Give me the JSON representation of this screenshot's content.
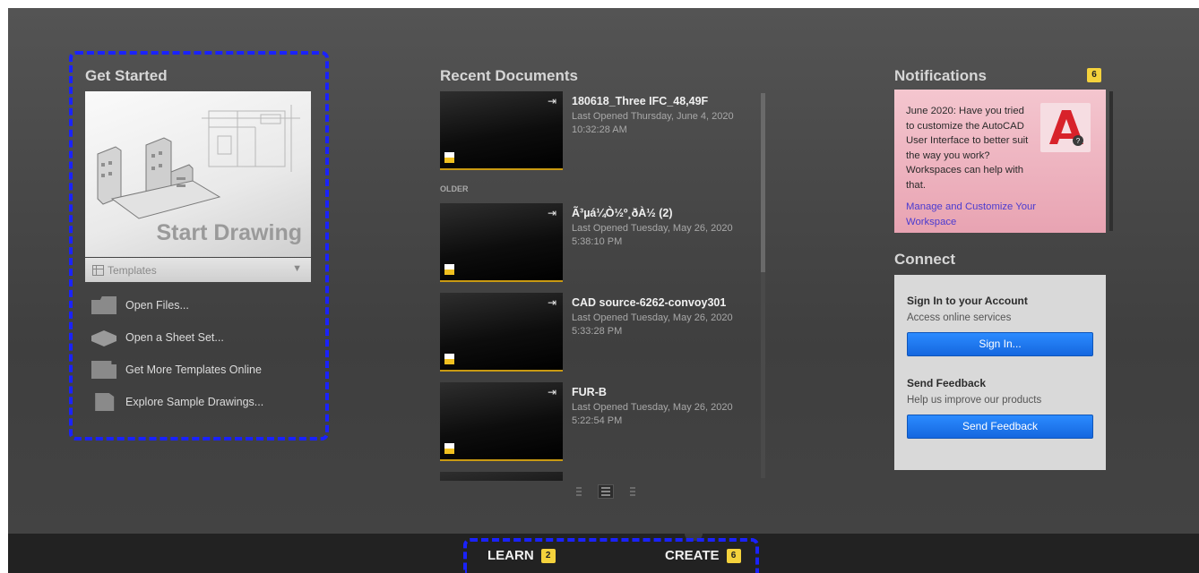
{
  "get_started": {
    "title": "Get Started",
    "start_drawing": "Start Drawing",
    "templates_label": "Templates",
    "links": [
      {
        "label": "Open Files...",
        "icon": "folder-icon"
      },
      {
        "label": "Open a Sheet Set...",
        "icon": "sheet-set-icon"
      },
      {
        "label": "Get More Templates Online",
        "icon": "templates-online-icon"
      },
      {
        "label": "Explore Sample Drawings...",
        "icon": "sample-drawings-icon"
      }
    ]
  },
  "recent": {
    "title": "Recent Documents",
    "older_label": "OLDER",
    "docs": [
      {
        "name": "180618_Three IFC_48,49F",
        "opened": "Last Opened Thursday, June 4, 2020",
        "time": "10:32:28 AM"
      },
      {
        "name": "Ã³µá¼Ò½º¸ðÀ½ (2)",
        "opened": "Last Opened Tuesday, May 26, 2020",
        "time": "5:38:10 PM"
      },
      {
        "name": "CAD source-6262-convoy301",
        "opened": "Last Opened Tuesday, May 26, 2020",
        "time": "5:33:28 PM"
      },
      {
        "name": "FUR-B",
        "opened": "Last Opened Tuesday, May 26, 2020",
        "time": "5:22:54 PM"
      }
    ]
  },
  "notifications": {
    "title": "Notifications",
    "count": "6",
    "message": "June 2020: Have you tried to customize the AutoCAD User Interface to better suit the way you work? Workspaces can help with that.",
    "link": "Manage and Customize Your Workspace"
  },
  "connect": {
    "title": "Connect",
    "signin_heading": "Sign In to your Account",
    "signin_sub": "Access online services",
    "signin_button": "Sign In...",
    "feedback_heading": "Send Feedback",
    "feedback_sub": "Help us improve our products",
    "feedback_button": "Send Feedback"
  },
  "bottom_tabs": {
    "learn": {
      "label": "LEARN",
      "count": "2"
    },
    "create": {
      "label": "CREATE",
      "count": "6"
    }
  },
  "colors": {
    "accent_blue": "#1a22ff",
    "badge_yellow": "#f4d23c",
    "button_blue": "#1f79ee",
    "notification_pink": "#f4c6cf"
  }
}
